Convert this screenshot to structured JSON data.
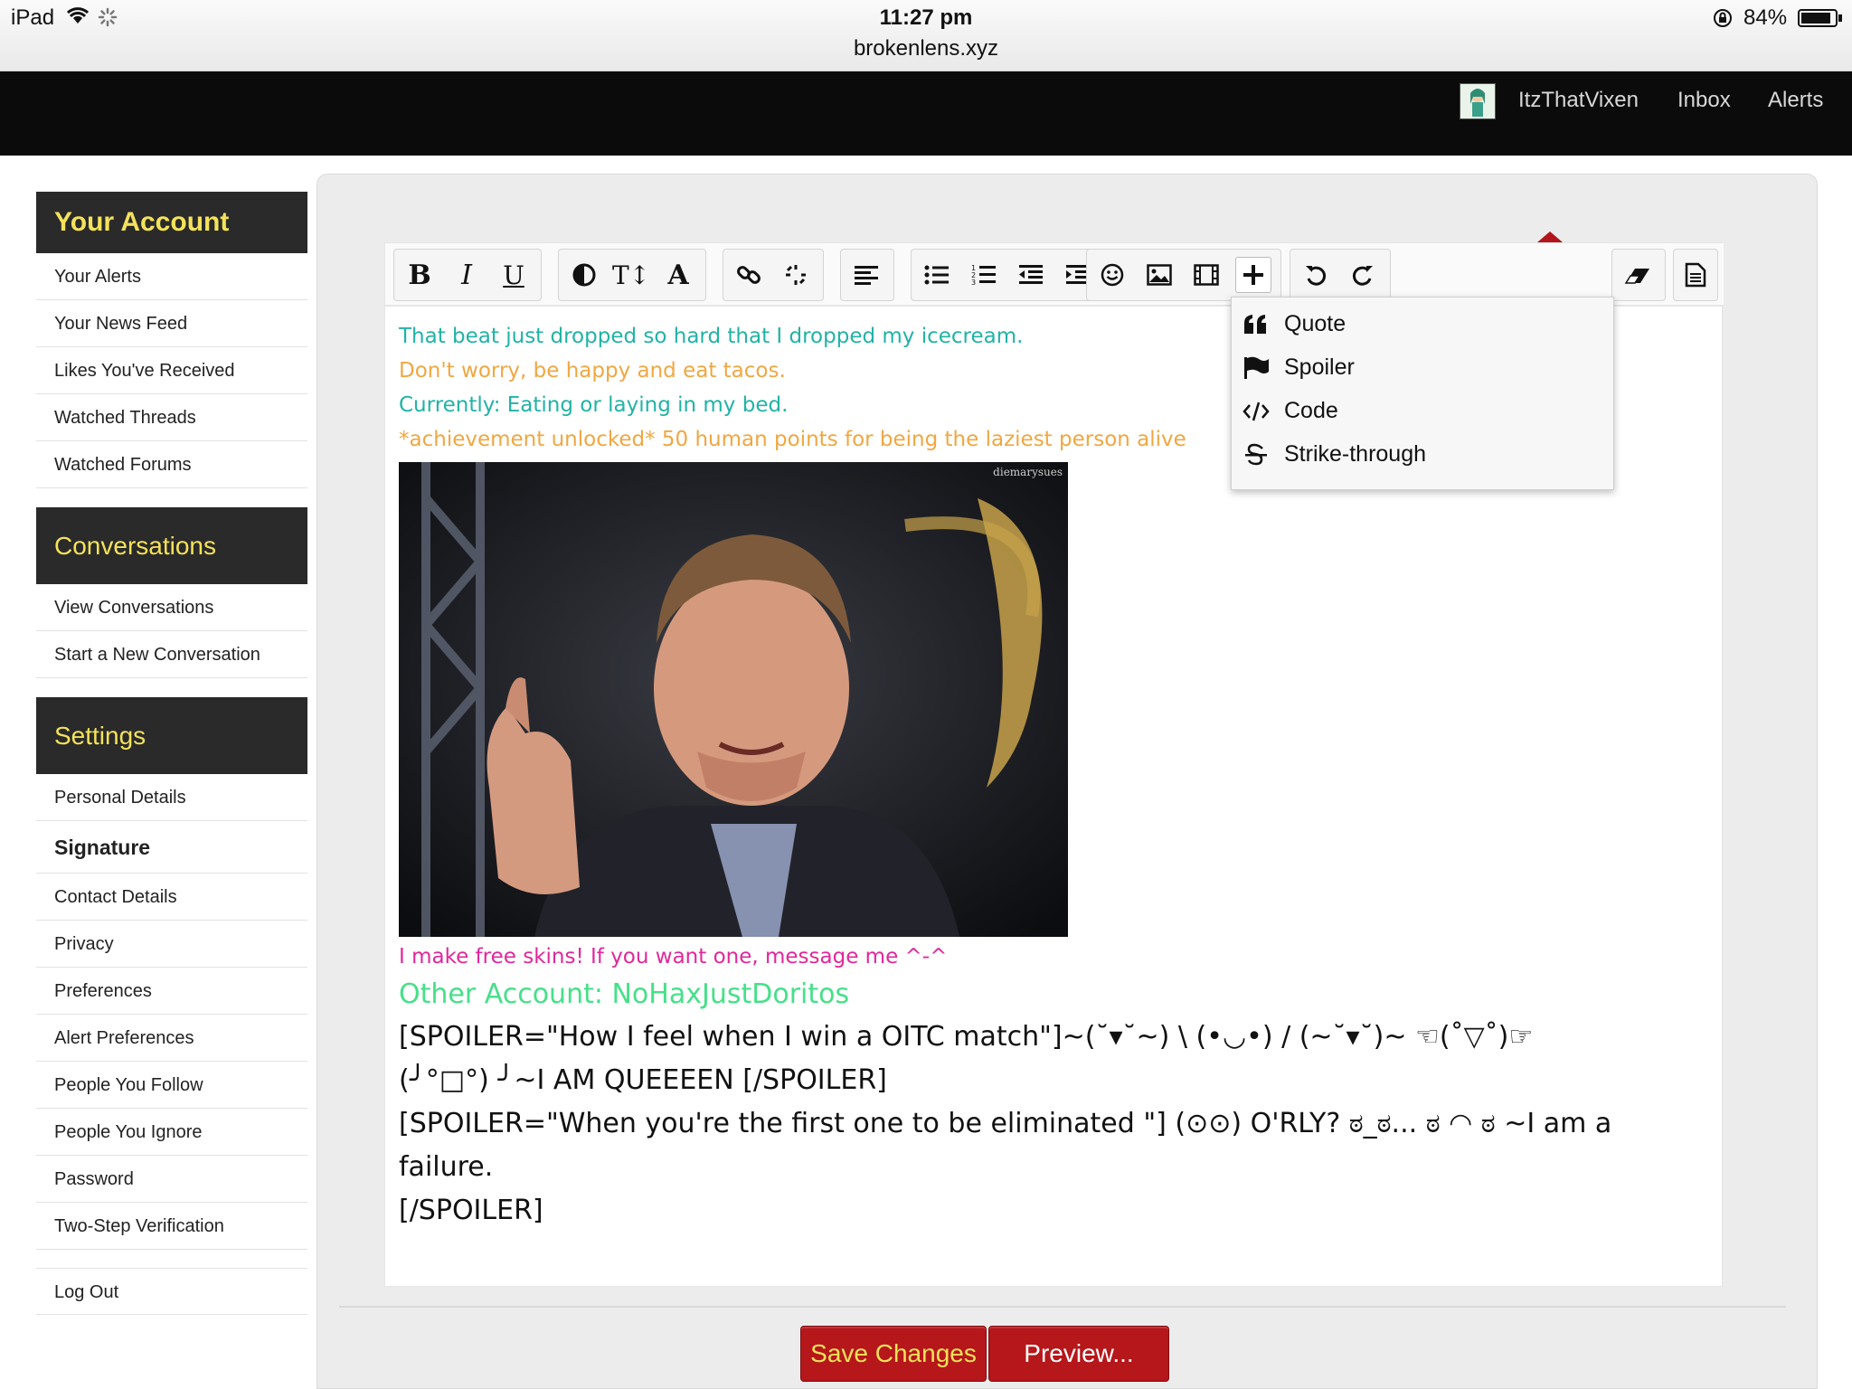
{
  "status_bar": {
    "device": "iPad",
    "time": "11:27 pm",
    "url": "brokenlens.xyz",
    "battery_pct": "84%",
    "battery_level": 0.84
  },
  "top_nav": {
    "username": "ItzThatVixen",
    "inbox": "Inbox",
    "alerts": "Alerts"
  },
  "sidebar": {
    "account_heading": "Your Account",
    "account_items": [
      "Your Alerts",
      "Your News Feed",
      "Likes You've Received",
      "Watched Threads",
      "Watched Forums"
    ],
    "conversations_heading": "Conversations",
    "conversation_items": [
      "View Conversations",
      "Start a New Conversation"
    ],
    "settings_heading": "Settings",
    "settings_items": [
      "Personal Details",
      "Signature",
      "Contact Details",
      "Privacy",
      "Preferences",
      "Alert Preferences",
      "People You Follow",
      "People You Ignore",
      "Password",
      "Two-Step Verification"
    ],
    "active_item": "Signature",
    "logout": "Log Out"
  },
  "toolbar": {
    "groups": [
      [
        "bold-icon",
        "italic-icon",
        "underline-icon"
      ],
      [
        "contrast-icon",
        "text-size-icon",
        "font-icon"
      ],
      [
        "link-icon",
        "unlink-icon"
      ],
      [
        "align-left-icon"
      ],
      [
        "bullet-list-icon",
        "numbered-list-icon",
        "outdent-icon",
        "indent-icon"
      ],
      [
        "smiley-icon",
        "image-icon",
        "media-icon",
        "plus-icon"
      ],
      [
        "undo-icon",
        "redo-icon"
      ],
      [
        "eraser-icon"
      ],
      [
        "source-icon"
      ]
    ]
  },
  "insert_menu": {
    "items": [
      {
        "icon": "quote-icon",
        "label": "Quote"
      },
      {
        "icon": "flag-icon",
        "label": "Spoiler"
      },
      {
        "icon": "code-icon",
        "label": "Code"
      },
      {
        "icon": "strikethrough-icon",
        "label": "Strike-through"
      }
    ]
  },
  "signature": {
    "line1": "That beat just dropped so hard that I dropped my icecream.",
    "line2": "Don't worry, be happy and eat tacos.",
    "line3": "Currently: Eating or laying in my bed.",
    "line4": "*achievement unlocked* 50 human points for being the laziest person alive",
    "gif_credit": "diemarysues",
    "line5": "I make free skins! If you want one, message me ^-^",
    "line6": "Other Account: NoHaxJustDoritos",
    "spoiler1_a": "[SPOILER=\"How I feel when I win a OITC match\"]~(˘▾˘~) \\ (•◡•) / (~˘▾˘)~ ☜(˚▽˚)☞",
    "spoiler1_b": "(╯°□°) ╯~I AM QUEEEEN [/SPOILER]",
    "spoiler2_a": "[SPOILER=\"When you're the first one to be eliminated \"]   (⊙⊙) O'RLY? ಠ_ಠ... ಠ ◠ ಠ ~I am a",
    "spoiler2_b": "failure.",
    "spoiler2_c": "[/SPOILER]"
  },
  "colors": {
    "teal": "#21b3a6",
    "orange": "#f0a742",
    "pink": "#e2279a",
    "green": "#46e089",
    "heading_yellow": "#f4e25a",
    "button_red": "#b5171b"
  },
  "actions": {
    "save": "Save Changes",
    "preview": "Preview..."
  }
}
